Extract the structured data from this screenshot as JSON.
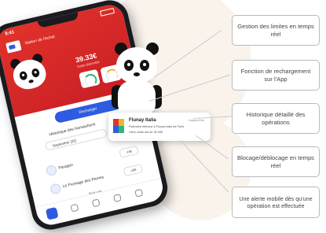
{
  "phone": {
    "status_time": "9:41",
    "card_name": "Station de l'Achat",
    "balance": "39.33€",
    "balance_sub": "Solde disponible",
    "recharge_label": "Recharger",
    "history_title": "Historique des transactions",
    "month_pill": "Septembre 202",
    "transactions": [
      {
        "label": "Paragon",
        "amount": "-15€"
      },
      {
        "label": "Le Fromage des Pierres",
        "amount": "-10€"
      }
    ],
    "see_all": "Tout voir"
  },
  "notification": {
    "merchant": "Flunay Italia",
    "date": "Aujourd'hui",
    "line1": "Paiement effectué à Flunay Italia de Paris",
    "line2": "Votre solde est de 39.33€"
  },
  "callouts": [
    "Gestion des limites en temps réel",
    "Fonction de rechargement sur l'App",
    "Historique détaillé des opérations",
    "Blocage/déblocage en temps réel",
    "Une alerte mobile dès qu'une opération est effectuée"
  ],
  "colors": {
    "brand_red": "#d9262a",
    "brand_blue": "#2f5be0",
    "callout_border": "#b9b9b9"
  },
  "icons": [
    "panda-mascot",
    "card-icon",
    "home-icon",
    "wallet-icon",
    "star-icon",
    "chart-icon",
    "user-icon"
  ]
}
